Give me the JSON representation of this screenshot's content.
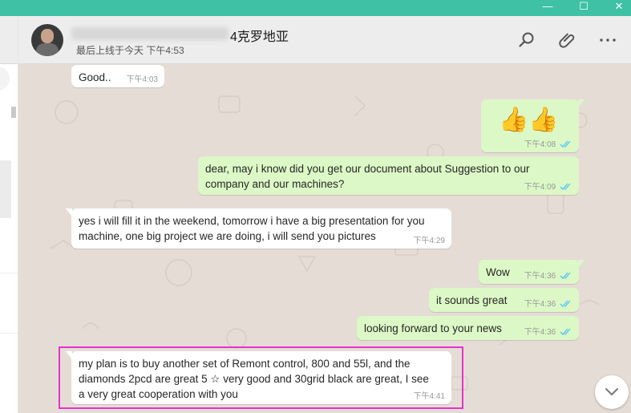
{
  "window": {
    "minimize_glyph": "—",
    "maximize_glyph": "☐",
    "close_glyph": "✕"
  },
  "header": {
    "contact_name": "4克罗地亚",
    "last_seen": "最后上线于今天 下午4:53",
    "icons": [
      "search-icon",
      "attach-icon",
      "more-icon"
    ]
  },
  "messages": [
    {
      "id": "m1",
      "direction": "incoming",
      "text": [
        "Good.."
      ],
      "time": "下午4:03"
    },
    {
      "id": "m2",
      "direction": "outgoing",
      "text": [
        "👍👍"
      ],
      "time": "下午4:08",
      "ticks": "read"
    },
    {
      "id": "m3",
      "direction": "outgoing",
      "text": [
        "dear, may i know did you get our document about Suggestion  to our",
        "company and our machines?"
      ],
      "time": "下午4:09",
      "ticks": "read"
    },
    {
      "id": "m4",
      "direction": "incoming",
      "text": [
        "yes i will fill it in the weekend, tomorrow i have a big presentation for you",
        "machine, one big project we are doing, i will send you pictures"
      ],
      "time": "下午4:29"
    },
    {
      "id": "m5",
      "direction": "outgoing",
      "text": [
        "Wow"
      ],
      "time": "下午4:36",
      "ticks": "read"
    },
    {
      "id": "m6",
      "direction": "outgoing",
      "text": [
        "it sounds great"
      ],
      "time": "下午4:36",
      "ticks": "read"
    },
    {
      "id": "m7",
      "direction": "outgoing",
      "text": [
        "looking forward to your news"
      ],
      "time": "下午4:36",
      "ticks": "read"
    },
    {
      "id": "m8",
      "direction": "incoming",
      "text": [
        "my plan is to buy another set of Remont control, 800 and 55l, and the",
        "diamonds 2pcd are great 5 ☆ very good and 30grid black are great, I see",
        "a very great cooperation with you"
      ],
      "time": "下午4:41",
      "highlighted": true
    }
  ],
  "colors": {
    "titlebar": "#3fc1a5",
    "header_bg": "#ededed",
    "chat_bg": "#e5ddd5",
    "incoming_bubble": "#ffffff",
    "outgoing_bubble": "#dcf8c6",
    "read_ticks": "#4fc3f7",
    "highlight_border": "#e631cf"
  },
  "scroll_button_icon": "chevron-down-icon"
}
